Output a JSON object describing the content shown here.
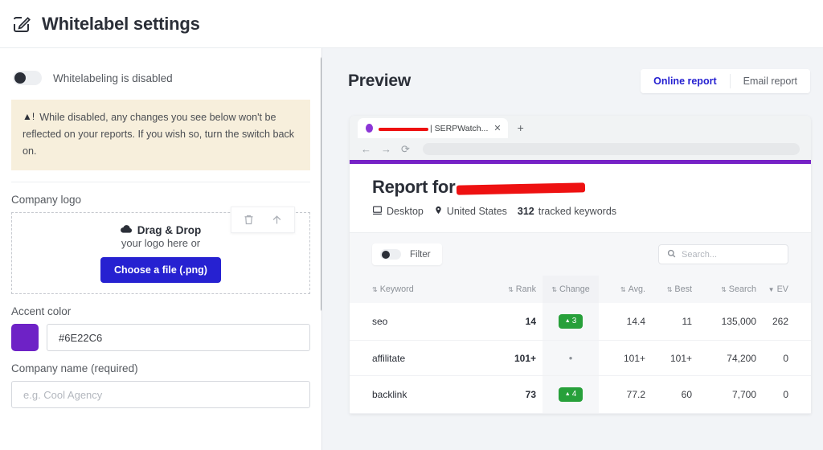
{
  "header": {
    "title": "Whitelabel settings",
    "icon": "edit-square-icon"
  },
  "settings": {
    "whitelabel_toggle": {
      "label": "Whitelabeling is disabled",
      "state": "off"
    },
    "warning": {
      "icon": "warning-triangle-icon",
      "text": "While disabled, any changes you see below won't be reflected on your reports. If you wish so, turn the switch back on."
    },
    "company_logo": {
      "label": "Company logo",
      "dropzone_title": "Drag & Drop",
      "dropzone_subtitle": "your logo here or",
      "choose_button": "Choose a file (.png)",
      "actions": [
        "trash-icon",
        "upload-icon"
      ]
    },
    "accent_color": {
      "label": "Accent color",
      "value": "#6E22C6",
      "swatch_hex": "#6E22C6"
    },
    "company_name": {
      "label": "Company name (required)",
      "value": "",
      "placeholder": "e.g. Cool Agency"
    }
  },
  "preview": {
    "title": "Preview",
    "tabs": [
      {
        "label": "Online report",
        "active": true
      },
      {
        "label": "Email report",
        "active": false
      }
    ],
    "browser": {
      "tab_title_suffix": "| SERPWatch...",
      "tab_title_redacted": true,
      "close_glyph": "✕",
      "newtab_glyph": "+",
      "nav": {
        "back": "←",
        "forward": "→",
        "reload": "⟳"
      },
      "url": ""
    },
    "report": {
      "accent_bar_hex": "#7622C6",
      "title_prefix": "Report for",
      "title_redacted": true,
      "meta": {
        "device": "Desktop",
        "device_icon": "monitor-icon",
        "location": "United States",
        "location_icon": "map-pin-icon",
        "keyword_count": "312",
        "keyword_count_suffix": "tracked keywords"
      },
      "toolbar": {
        "filter_label": "Filter",
        "filter_state": "off",
        "search_placeholder": "Search...",
        "search_value": "",
        "search_icon": "search-icon"
      },
      "table": {
        "columns": [
          {
            "key": "keyword",
            "label": "Keyword",
            "sort": "both"
          },
          {
            "key": "rank",
            "label": "Rank",
            "sort": "both"
          },
          {
            "key": "change",
            "label": "Change",
            "sort": "both"
          },
          {
            "key": "avg",
            "label": "Avg.",
            "sort": "both"
          },
          {
            "key": "best",
            "label": "Best",
            "sort": "both"
          },
          {
            "key": "search",
            "label": "Search",
            "sort": "both"
          },
          {
            "key": "ev",
            "label": "EV",
            "sort": "desc"
          }
        ],
        "rows": [
          {
            "keyword": "seo",
            "rank": "14",
            "change": "3",
            "change_type": "up",
            "avg": "14.4",
            "best": "11",
            "search": "135,000",
            "ev": "262"
          },
          {
            "keyword": "affilitate",
            "rank": "101+",
            "change": "",
            "change_type": "none",
            "avg": "101+",
            "best": "101+",
            "search": "74,200",
            "ev": "0"
          },
          {
            "keyword": "backlink",
            "rank": "73",
            "change": "4",
            "change_type": "up",
            "avg": "77.2",
            "best": "60",
            "search": "7,700",
            "ev": "0"
          }
        ]
      }
    }
  }
}
